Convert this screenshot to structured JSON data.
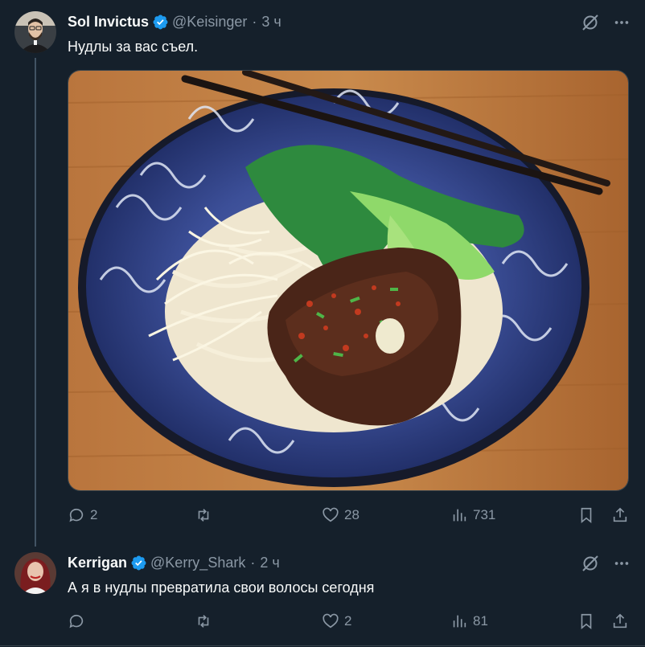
{
  "tweet": {
    "author_name": "Sol Invictus",
    "handle": "@Keisinger",
    "time": "3 ч",
    "text": "Нудлы за вас съел.",
    "replies": "2",
    "likes": "28",
    "views": "731",
    "media_description_icon": "noodle-bowl-photo"
  },
  "reply": {
    "author_name": "Kerrigan",
    "handle": "@Kerry_Shark",
    "time": "2 ч",
    "text": "А я в нудлы превратила свои волосы сегодня",
    "replies": "",
    "likes": "2",
    "views": "81"
  },
  "separator": "·",
  "colors": {
    "background": "#15202b",
    "muted": "#8b98a5",
    "verified": "#1d9bf0",
    "text": "#f7f9f9"
  }
}
